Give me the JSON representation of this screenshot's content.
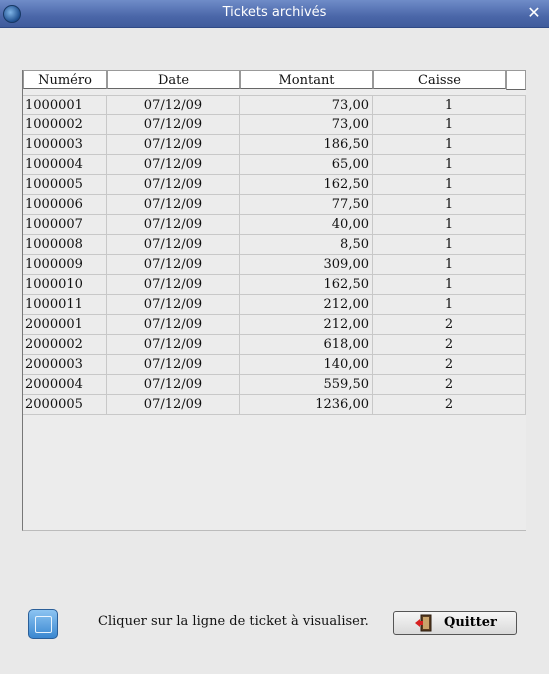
{
  "window": {
    "title": "Tickets archivés"
  },
  "table": {
    "headers": [
      "Numéro",
      "Date",
      "Montant",
      "Caisse"
    ],
    "rows": [
      [
        "1000001",
        "07/12/09",
        "73,00",
        "1"
      ],
      [
        "1000002",
        "07/12/09",
        "73,00",
        "1"
      ],
      [
        "1000003",
        "07/12/09",
        "186,50",
        "1"
      ],
      [
        "1000004",
        "07/12/09",
        "65,00",
        "1"
      ],
      [
        "1000005",
        "07/12/09",
        "162,50",
        "1"
      ],
      [
        "1000006",
        "07/12/09",
        "77,50",
        "1"
      ],
      [
        "1000007",
        "07/12/09",
        "40,00",
        "1"
      ],
      [
        "1000008",
        "07/12/09",
        "8,50",
        "1"
      ],
      [
        "1000009",
        "07/12/09",
        "309,00",
        "1"
      ],
      [
        "1000010",
        "07/12/09",
        "162,50",
        "1"
      ],
      [
        "1000011",
        "07/12/09",
        "212,00",
        "1"
      ],
      [
        "2000001",
        "07/12/09",
        "212,00",
        "2"
      ],
      [
        "2000002",
        "07/12/09",
        "618,00",
        "2"
      ],
      [
        "2000003",
        "07/12/09",
        "140,00",
        "2"
      ],
      [
        "2000004",
        "07/12/09",
        "559,50",
        "2"
      ],
      [
        "2000005",
        "07/12/09",
        "1236,00",
        "2"
      ]
    ]
  },
  "footer": {
    "hint": "Cliquer sur la ligne de ticket à visualiser.",
    "quit_label": "Quitter"
  },
  "icons": {
    "app": "app-icon",
    "close": "close-icon",
    "info": "info-icon",
    "exit": "exit-door-icon"
  }
}
